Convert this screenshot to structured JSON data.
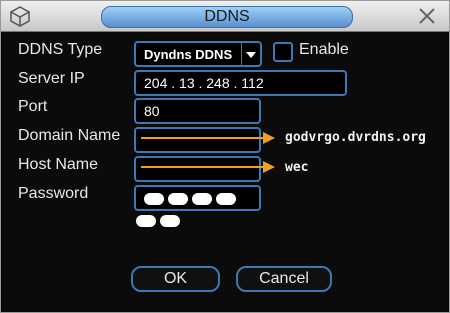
{
  "window": {
    "title": "DDNS",
    "logo_icon": "camera-cube-icon",
    "close_icon": "close-icon"
  },
  "form": {
    "ddns_type": {
      "label": "DDNS Type",
      "value": "Dyndns DDNS"
    },
    "enable": {
      "label": "Enable",
      "checked": false
    },
    "server_ip": {
      "label": "Server IP",
      "value": "204 . 13 . 248 . 112"
    },
    "port": {
      "label": "Port",
      "value": "80"
    },
    "domain_name": {
      "label": "Domain Name",
      "value": "",
      "annotation": "godvrgo.dvrdns.org"
    },
    "host_name": {
      "label": "Host Name",
      "value": "",
      "annotation": "wec"
    },
    "password": {
      "label": "Password",
      "value": "••••••"
    }
  },
  "buttons": {
    "ok": "OK",
    "cancel": "Cancel"
  },
  "colors": {
    "field_border": "#3c78b4",
    "arrow": "#f0a020",
    "background": "#0b0b0b"
  }
}
